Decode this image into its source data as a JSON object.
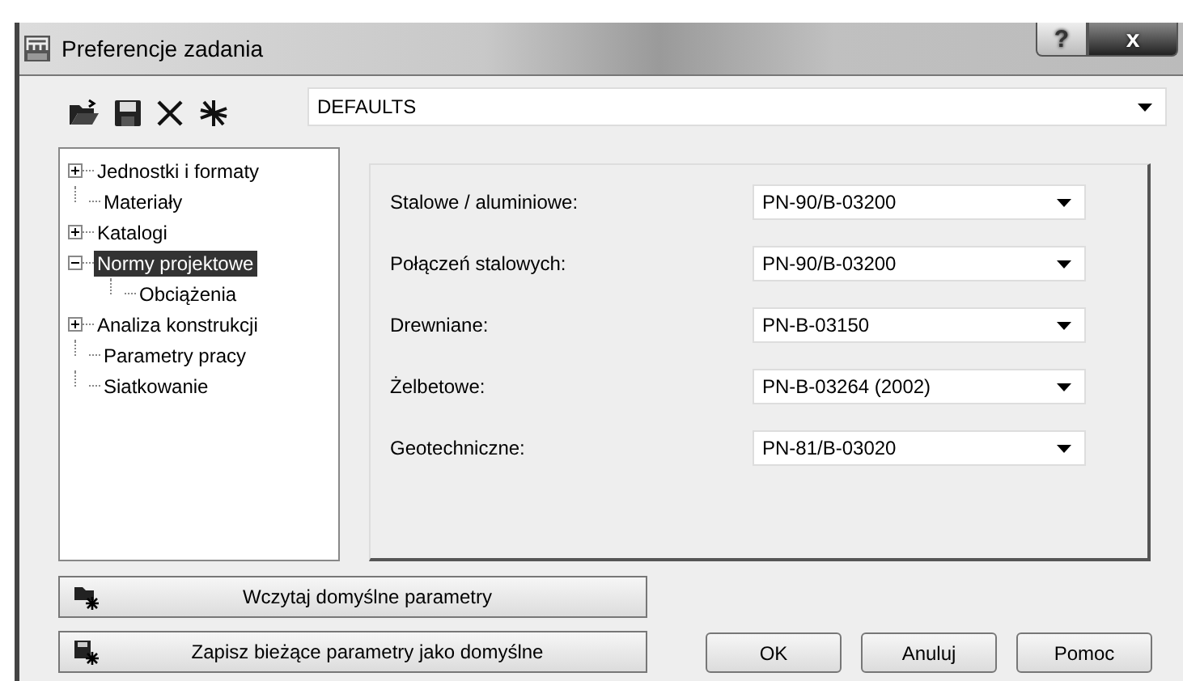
{
  "window": {
    "title": "Preferencje zadania",
    "help_button": "?",
    "close_button": "x"
  },
  "preset": {
    "value": "DEFAULTS"
  },
  "tree": [
    {
      "label": "Jednostki i formaty",
      "expanded": false,
      "selected": false
    },
    {
      "label": "Materiały",
      "selected": false
    },
    {
      "label": "Katalogi",
      "expanded": false,
      "selected": false
    },
    {
      "label": "Normy projektowe",
      "expanded": true,
      "selected": true,
      "children": [
        {
          "label": "Obciążenia",
          "selected": false
        }
      ]
    },
    {
      "label": "Analiza konstrukcji",
      "expanded": false,
      "selected": false
    },
    {
      "label": "Parametry pracy",
      "selected": false
    },
    {
      "label": "Siatkowanie",
      "selected": false
    }
  ],
  "norms": [
    {
      "label": "Stalowe / aluminiowe:",
      "value": "PN-90/B-03200"
    },
    {
      "label": "Połączeń stalowych:",
      "value": "PN-90/B-03200"
    },
    {
      "label": "Drewniane:",
      "value": "PN-B-03150"
    },
    {
      "label": "Żelbetowe:",
      "value": "PN-B-03264 (2002)"
    },
    {
      "label": "Geotechniczne:",
      "value": "PN-81/B-03020"
    }
  ],
  "defaults_buttons": [
    {
      "label": "Wczytaj domyślne parametry",
      "kind": "load"
    },
    {
      "label": "Zapisz bieżące parametry jako domyślne",
      "kind": "save"
    }
  ],
  "buttons": [
    "OK",
    "Anuluj",
    "Pomoc"
  ]
}
